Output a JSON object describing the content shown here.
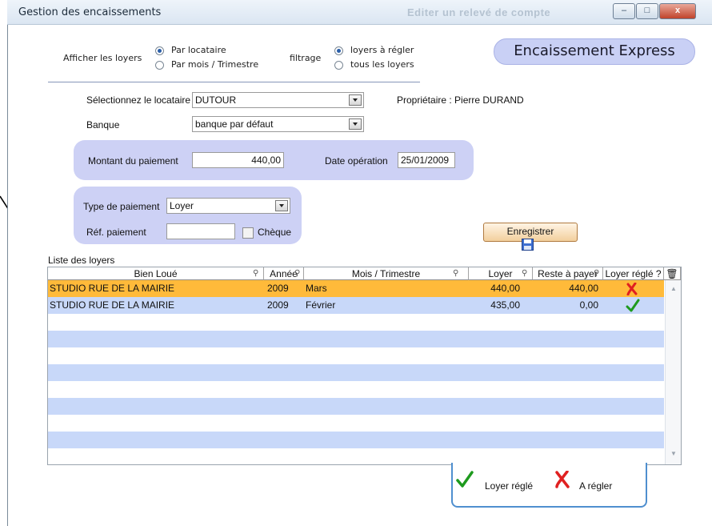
{
  "window": {
    "title": "Gestion des encaissements",
    "ghost_title": "Editer un relevé de compte",
    "controls": {
      "minimize": "–",
      "maximize": "□",
      "close": "x"
    }
  },
  "filters": {
    "display_label": "Afficher les loyers",
    "display_options": [
      "Par locataire",
      "Par mois / Trimestre"
    ],
    "display_selected": "Par locataire",
    "filter_label": "filtrage",
    "filter_options": [
      "loyers à régler",
      "tous les loyers"
    ],
    "filter_selected": "loyers à régler"
  },
  "express_button": "Encaissement Express",
  "form": {
    "tenant_label": "Sélectionnez le locataire",
    "tenant_value": "DUTOUR",
    "owner_text": "Propriétaire : Pierre DURAND",
    "bank_label": "Banque",
    "bank_value": "banque par défaut",
    "amount_label": "Montant du paiement",
    "amount_value": "440,00",
    "date_label": "Date opération",
    "date_value": "25/01/2009",
    "payment_type_label": "Type de paiement",
    "payment_type_value": "Loyer",
    "payment_ref_label": "Réf. paiement",
    "payment_ref_value": "",
    "cheque_label": "Chèque",
    "cheque_checked": false,
    "save_label": "Enregistrer"
  },
  "grid": {
    "caption": "Liste des loyers",
    "columns": [
      "Bien Loué",
      "Année",
      "Mois / Trimestre",
      "Loyer",
      "Reste à payer",
      "Loyer réglé ?"
    ],
    "rows": [
      {
        "bien": "STUDIO RUE DE LA MAIRIE",
        "annee": "2009",
        "mois": "Mars",
        "loyer": "440,00",
        "reste": "440,00",
        "regle": "cross-icon",
        "selected": true
      },
      {
        "bien": "STUDIO RUE DE LA MAIRIE",
        "annee": "2009",
        "mois": "Février",
        "loyer": "435,00",
        "reste": "0,00",
        "regle": "check-icon",
        "selected": false
      }
    ]
  },
  "legend": {
    "paid_label": "Loyer réglé",
    "unpaid_label": "A régler"
  },
  "colors": {
    "selected_row": "#ffba3a",
    "stripe": "#c8d8f9",
    "panel": "#cdd1f5",
    "check": "#1e9a1e",
    "cross": "#e02020"
  }
}
